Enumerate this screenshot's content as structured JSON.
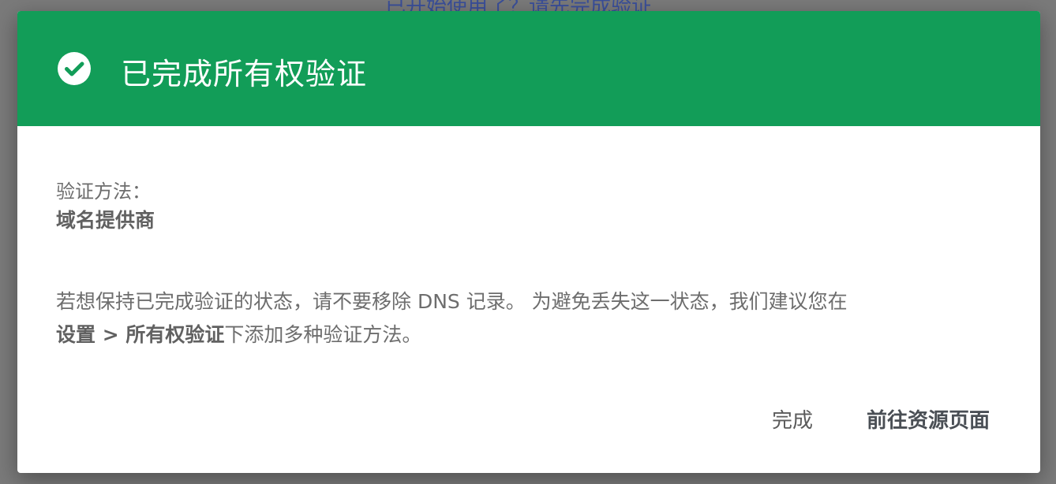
{
  "backdrop": {
    "partial_text": "已开始使用了？请先完成验证"
  },
  "dialog": {
    "title": "已完成所有权验证",
    "icon": "check-circle-icon",
    "header_color": "#129d58",
    "method_label": "验证方法：",
    "method_value": "域名提供商",
    "info_line1": "若想保持已完成验证的状态，请不要移除 DNS 记录。 为避免丢失这一状态，我们建议您在",
    "info_bold": "设置 > 所有权验证",
    "info_suffix": "下添加多种验证方法。",
    "done_button": "完成",
    "goto_button": "前往资源页面"
  }
}
